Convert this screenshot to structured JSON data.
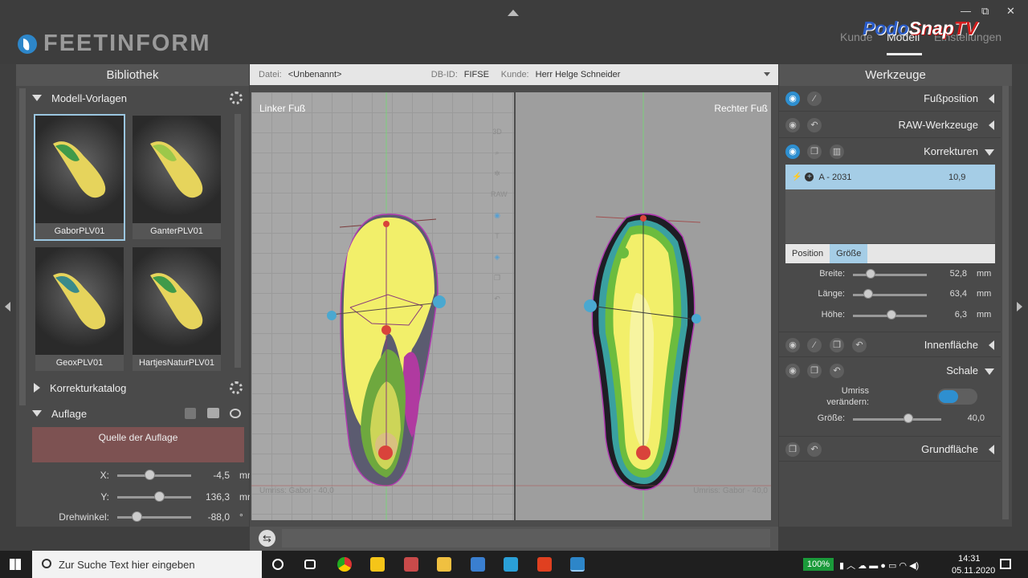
{
  "app": {
    "logo_text": "FEETINFORM",
    "watermark": {
      "podo": "Podo",
      "snap": "Snap",
      "tv": "TV"
    }
  },
  "top_nav": [
    "Kunde",
    "Modell",
    "Einstellungen"
  ],
  "window_controls": [
    "—",
    "⧉",
    "✕"
  ],
  "left_panel": {
    "title": "Bibliothek",
    "modell_vorlagen": "Modell-Vorlagen",
    "thumbnails": [
      "GaborPLV01",
      "GanterPLV01",
      "GeoxPLV01",
      "HartjesNaturPLV01"
    ],
    "korrekturkatalog": "Korrekturkatalog",
    "auflage": "Auflage",
    "source_label": "Quelle der Auflage",
    "sliders": [
      {
        "label": "X:",
        "value": "-4,5",
        "unit": "mm",
        "pos": 0.43
      },
      {
        "label": "Y:",
        "value": "136,3",
        "unit": "mm",
        "pos": 0.56
      },
      {
        "label": "Drehwinkel:",
        "value": "-88,0",
        "unit": "°",
        "pos": 0.26
      }
    ]
  },
  "file_bar": {
    "datei_label": "Datei:",
    "datei_value": "<Unbenannt>",
    "dbid_label": "DB-ID:",
    "dbid_value": "FIFSE",
    "kunde_label": "Kunde:",
    "kunde_value": "Herr Helge Schneider"
  },
  "views": {
    "left_label": "Linker Fuß",
    "right_label": "Rechter Fuß",
    "left_umriss": "Umriss: Gabor - 40,0",
    "right_umriss": "Umriss: Gabor - 40,0",
    "view_tools": [
      "3D",
      "RAW"
    ]
  },
  "right_panel": {
    "title": "Werkzeuge",
    "rows": {
      "fussposition": "Fußposition",
      "raw": "RAW-Werkzeuge",
      "korrekturen": "Korrekturen",
      "innenflaeche": "Innenfläche",
      "schale": "Schale",
      "grundflaeche": "Grundfläche"
    },
    "korrektur_item": {
      "name": "A - 2031",
      "value": "10,9"
    },
    "tabs": [
      "Position",
      "Größe"
    ],
    "sliders": [
      {
        "label": "Breite:",
        "value": "52,8",
        "unit": "mm",
        "pos": 0.24
      },
      {
        "label": "Länge:",
        "value": "63,4",
        "unit": "mm",
        "pos": 0.21
      },
      {
        "label": "Höhe:",
        "value": "6,3",
        "unit": "mm",
        "pos": 0.52
      }
    ],
    "umriss_label": "Umriss\nverändern:",
    "groesse": {
      "label": "Größe:",
      "value": "40,0",
      "pos": 0.63
    }
  },
  "taskbar": {
    "search_placeholder": "Zur Suche Text hier eingeben",
    "battery": "100%",
    "time": "14:31",
    "date": "05.11.2020"
  }
}
